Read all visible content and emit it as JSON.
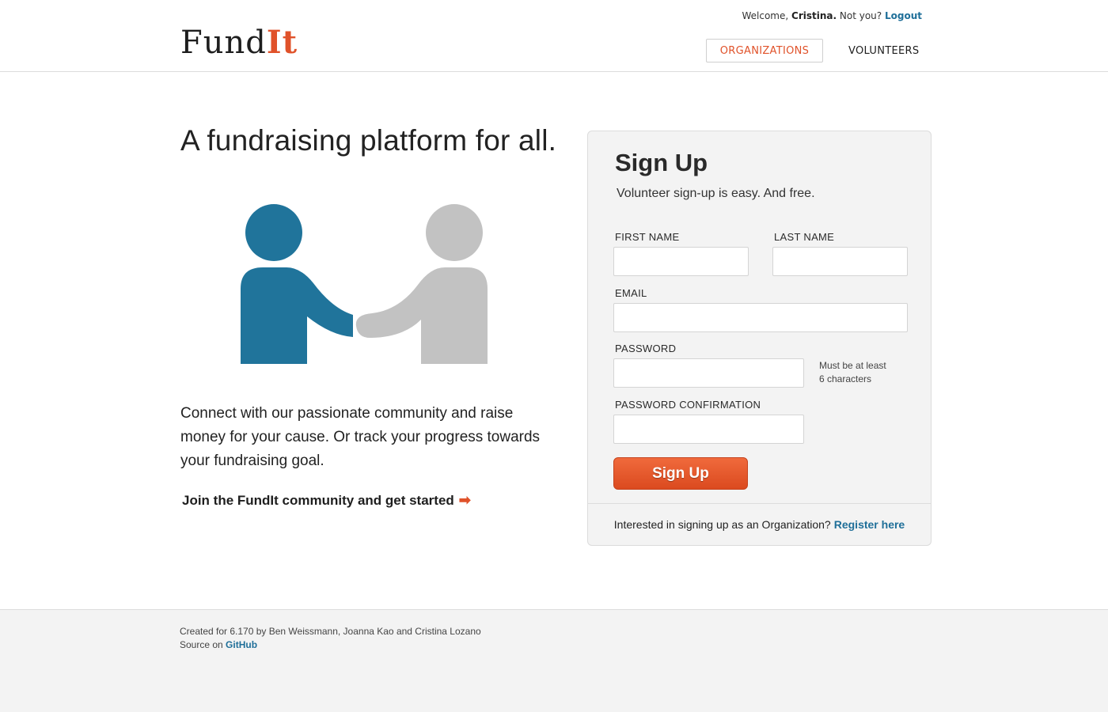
{
  "header": {
    "logo_main": "Fund",
    "logo_accent": "It",
    "welcome_prefix": "Welcome,",
    "user_name": "Cristina.",
    "not_you": "Not you?",
    "logout": "Logout",
    "nav": [
      {
        "label": "ORGANIZATIONS",
        "active": true
      },
      {
        "label": "VOLUNTEERS",
        "active": false
      }
    ]
  },
  "hero": {
    "tagline": "A fundraising platform for all.",
    "illustration_icon": "handshake-icon",
    "description": "Connect with our passionate community and raise money for your cause. Or track your progress towards your fundraising goal.",
    "cta": "Join the FundIt community and get started"
  },
  "signup": {
    "title": "Sign Up",
    "subtitle": "Volunteer sign-up is easy. And free.",
    "fields": {
      "first_name": {
        "label": "FIRST NAME",
        "value": ""
      },
      "last_name": {
        "label": "LAST NAME",
        "value": ""
      },
      "email": {
        "label": "EMAIL",
        "value": ""
      },
      "password": {
        "label": "PASSWORD",
        "value": "",
        "hint_line1": "Must be at least",
        "hint_line2": "6 characters"
      },
      "password_confirmation": {
        "label": "PASSWORD CONFIRMATION",
        "value": ""
      }
    },
    "button": "Sign Up",
    "org_prompt": "Interested in signing up as an Organization?",
    "org_link": "Register here"
  },
  "footer": {
    "credit": "Created for 6.170 by Ben Weissmann, Joanna Kao and Cristina Lozano",
    "source_prefix": "Source on",
    "source_link": "GitHub"
  },
  "colors": {
    "accent": "#e0522a",
    "link": "#1f6f99",
    "figure_blue": "#20749b",
    "figure_gray": "#c2c2c2"
  }
}
